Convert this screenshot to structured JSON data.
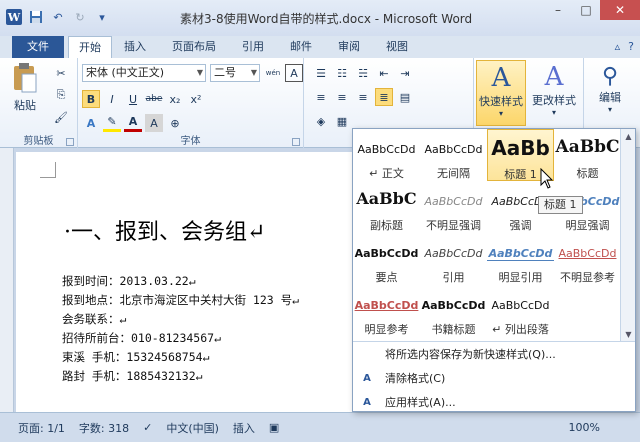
{
  "window": {
    "title": "素材3-8使用Word自带的样式.docx - Microsoft Word"
  },
  "qat": {
    "icons": [
      "word-logo-icon",
      "save-icon",
      "undo-icon",
      "redo-icon",
      "customize-icon"
    ],
    "logo": "W"
  },
  "tabs": {
    "file": "文件",
    "items": [
      "开始",
      "插入",
      "页面布局",
      "引用",
      "邮件",
      "审阅",
      "视图"
    ]
  },
  "ribbon": {
    "paste": "粘贴",
    "clipboard_group": "剪贴板",
    "font_name": "宋体 (中文正文)",
    "font_size": "二号",
    "font_group": "字体",
    "bold": "B",
    "italic": "I",
    "underline": "U",
    "strike": "abe",
    "subscript": "x₂",
    "superscript": "x²",
    "quick_styles": "快速样式",
    "change_styles": "更改样式",
    "editing": "编辑",
    "quick_styles_glyph": "A",
    "change_styles_glyph": "A",
    "wen": "wén",
    "font_a": "A"
  },
  "gallery": {
    "styles": [
      {
        "sample": "AaBbCcDd",
        "name": "↵ 正文"
      },
      {
        "sample": "AaBbCcDd",
        "name": "无间隔"
      },
      {
        "sample": "AaBb",
        "name": "标题 1"
      },
      {
        "sample": "AaBbC",
        "name": "标题"
      },
      {
        "sample": "AaBbC",
        "name": "副标题"
      },
      {
        "sample": "AaBbCcDd",
        "name": "不明显强调"
      },
      {
        "sample": "AaBbCcDd",
        "name": "强调"
      },
      {
        "sample": "AaBbCcDd",
        "name": "明显强调"
      },
      {
        "sample": "AaBbCcDd",
        "name": "要点"
      },
      {
        "sample": "AaBbCcDd",
        "name": "引用"
      },
      {
        "sample": "AaBbCcDd",
        "name": "明显引用"
      },
      {
        "sample": "AaBbCcDd",
        "name": "不明显参考"
      },
      {
        "sample": "AaBbCcDd",
        "name": "明显参考"
      },
      {
        "sample": "AaBbCcDd",
        "name": "书籍标题"
      },
      {
        "sample": "AaBbCcDd",
        "name": "↵ 列出段落"
      }
    ],
    "menu": [
      {
        "icon": "save-style-icon",
        "label": "将所选内容保存为新快速样式(Q)..."
      },
      {
        "icon": "clear-format-icon",
        "label": "清除格式(C)",
        "glyph": "A"
      },
      {
        "icon": "apply-style-icon",
        "label": "应用样式(A)...",
        "glyph": "A"
      }
    ],
    "tooltip": "标题 1"
  },
  "document": {
    "heading": "·一、报到、会务组↵",
    "lines": [
      "报到时间：2013.03.22↵",
      "报到地点：北京市海淀区中关村大街 123 号↵",
      "会务联系：↵",
      "招待所前台：010-81234567↵",
      "束溪 手机：15324568754↵",
      "路封 手机：1885432132↵"
    ]
  },
  "status": {
    "page": "页面: 1/1",
    "words": "字数: 318",
    "language": "中文(中国)",
    "mode": "插入",
    "zoom": "100%"
  }
}
